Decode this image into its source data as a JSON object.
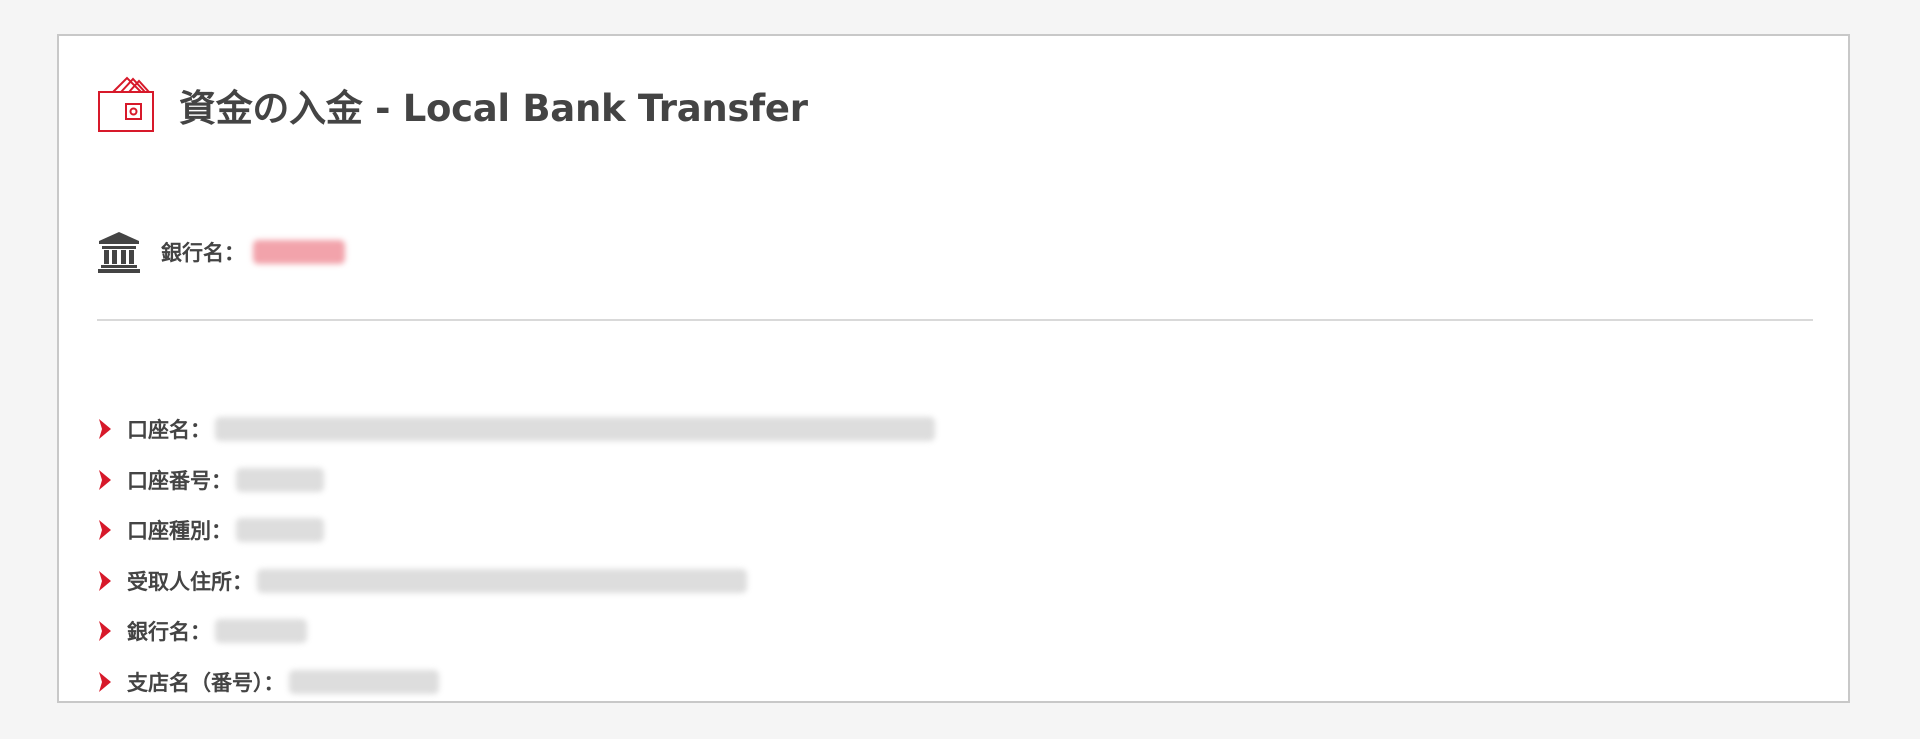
{
  "page": {
    "title": "資金の入金 - Local Bank Transfer",
    "icons": {
      "title": "wallet-icon",
      "bank": "bank-building-icon",
      "bullet": "red-chevron-icon"
    },
    "colors": {
      "accent": "#d7192a",
      "text": "#444444",
      "border": "#c8c8c8",
      "background": "#f5f5f5"
    }
  },
  "bank": {
    "label": "銀行名：",
    "value_redacted": true
  },
  "details": [
    {
      "label": "口座名：",
      "value_redacted": true
    },
    {
      "label": "口座番号：",
      "value_redacted": true
    },
    {
      "label": "口座種別：",
      "value_redacted": true
    },
    {
      "label": "受取人住所：",
      "value_redacted": true
    },
    {
      "label": "銀行名：",
      "value_redacted": true
    },
    {
      "label": "支店名（番号）：",
      "value_redacted": true
    }
  ]
}
